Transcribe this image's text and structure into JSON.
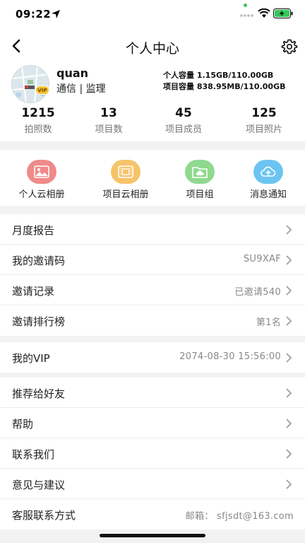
{
  "status": {
    "time": "09:22"
  },
  "nav": {
    "title": "个人中心"
  },
  "profile": {
    "username": "quan",
    "role": "通信 | 监理",
    "vip_badge": "VIP",
    "personal_capacity": "个人容量 1.15GB/110.00GB",
    "project_capacity": "项目容量 838.95MB/110.00GB"
  },
  "stats": [
    {
      "value": "1215",
      "label": "拍照数"
    },
    {
      "value": "13",
      "label": "项目数"
    },
    {
      "value": "45",
      "label": "项目成员"
    },
    {
      "value": "125",
      "label": "项目照片"
    }
  ],
  "shortcuts": [
    {
      "label": "个人云相册",
      "icon": "picture-icon",
      "color": "#ef8a8a"
    },
    {
      "label": "项目云相册",
      "icon": "film-icon",
      "color": "#f6c36a"
    },
    {
      "label": "项目组",
      "icon": "folder-cloud-icon",
      "color": "#8fd98f"
    },
    {
      "label": "消息通知",
      "icon": "cloud-upload-icon",
      "color": "#6cc4f2"
    }
  ],
  "menu": {
    "group1": [
      {
        "label": "月度报告",
        "value": ""
      },
      {
        "label": "我的邀请码",
        "value": "SU9XAF"
      },
      {
        "label": "邀请记录",
        "value": "已邀请540"
      },
      {
        "label": "邀请排行榜",
        "value": "第1名"
      }
    ],
    "group2": [
      {
        "label": "我的VIP",
        "value": "2074-08-30 15:56:00"
      }
    ],
    "group3": [
      {
        "label": "推荐给好友",
        "value": ""
      },
      {
        "label": "帮助",
        "value": ""
      },
      {
        "label": "联系我们",
        "value": ""
      },
      {
        "label": "意见与建议",
        "value": ""
      },
      {
        "label": "客服联系方式",
        "value": "邮箱： sfjsdt@163.com"
      }
    ]
  }
}
